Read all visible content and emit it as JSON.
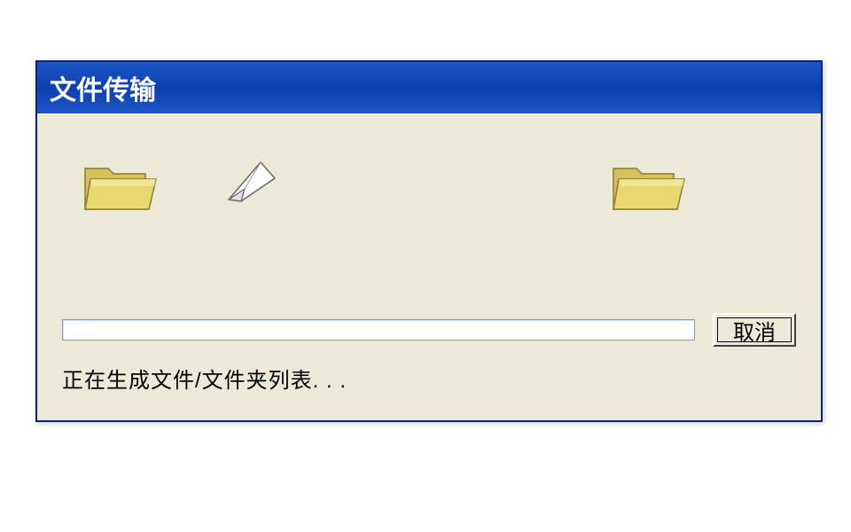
{
  "dialog": {
    "title": "文件传输",
    "cancel_label": "取消",
    "status_text": "正在生成文件/文件夹列表. . .",
    "icons": {
      "source_folder": "folder-open",
      "transfer": "flying-paper",
      "destination_folder": "folder-open"
    },
    "colors": {
      "titlebar_gradient_top": "#1c57c7",
      "titlebar_gradient_mid": "#0d3fb0",
      "content_bg": "#ece9d8",
      "border": "#0a246a",
      "folder_fill": "#e8d870",
      "folder_highlight": "#f5eda5"
    }
  }
}
